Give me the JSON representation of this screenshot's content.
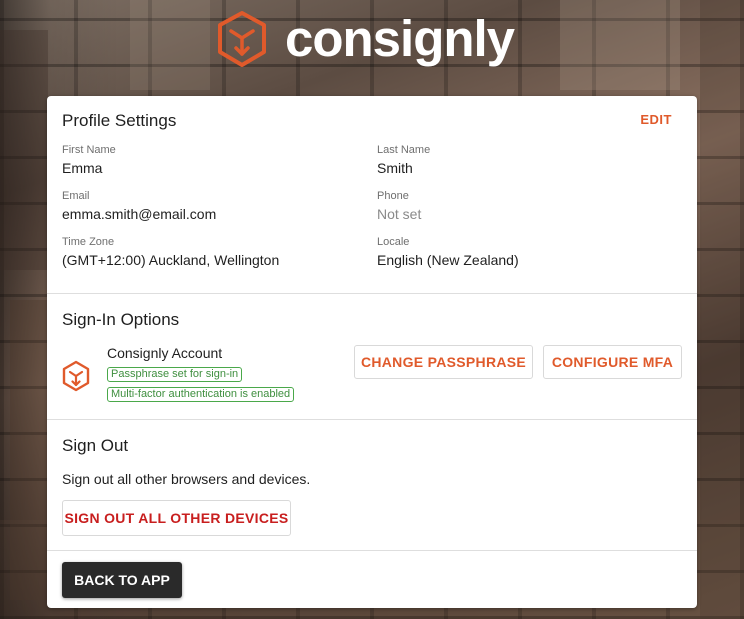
{
  "brand": {
    "name": "consignly",
    "logo_icon": "consignly-cube-logo-icon",
    "accent_color": "#e05a2b"
  },
  "profile": {
    "title": "Profile Settings",
    "edit_label": "EDIT",
    "fields": {
      "first_name": {
        "label": "First Name",
        "value": "Emma"
      },
      "last_name": {
        "label": "Last Name",
        "value": "Smith"
      },
      "email": {
        "label": "Email",
        "value": "emma.smith@email.com"
      },
      "phone": {
        "label": "Phone",
        "value": "Not set"
      },
      "time_zone": {
        "label": "Time Zone",
        "value": "(GMT+12:00) Auckland, Wellington"
      },
      "locale": {
        "label": "Locale",
        "value": "English (New Zealand)"
      }
    }
  },
  "signin": {
    "title": "Sign-In Options",
    "account_name": "Consignly Account",
    "account_icon": "consignly-cube-icon",
    "badges": [
      "Passphrase set for sign-in",
      "Multi-factor authentication is enabled"
    ],
    "badge_color": "#4aa84a",
    "change_passphrase_label": "CHANGE PASSPHRASE",
    "configure_mfa_label": "CONFIGURE MFA"
  },
  "signout": {
    "title": "Sign Out",
    "description": "Sign out all other browsers and devices.",
    "button_label": "SIGN OUT ALL OTHER DEVICES",
    "button_color": "#c81e1e"
  },
  "footer": {
    "back_label": "BACK TO APP"
  }
}
